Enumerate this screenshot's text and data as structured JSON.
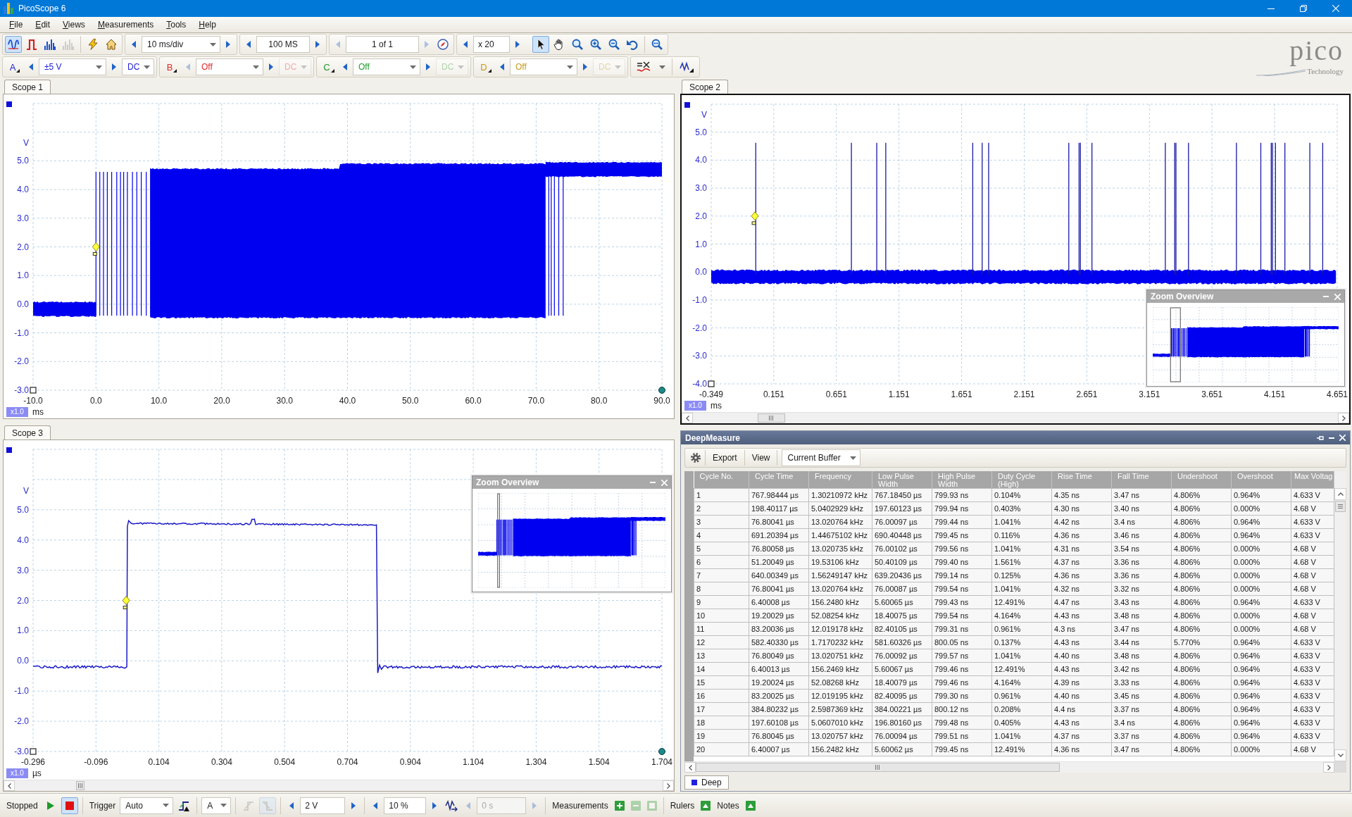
{
  "window": {
    "title": "PicoScope 6"
  },
  "menu": [
    "File",
    "Edit",
    "Views",
    "Measurements",
    "Tools",
    "Help"
  ],
  "toolbar": {
    "view_modes": [
      {
        "selected": true,
        "disabled": false
      },
      {
        "selected": false,
        "disabled": false
      },
      {
        "selected": false,
        "disabled": false
      },
      {
        "selected": false,
        "disabled": true
      }
    ],
    "steppers": [
      {
        "kind": "dropdown",
        "value": "10 ms/div",
        "prev_enabled": true,
        "next_enabled": true
      },
      {
        "kind": "field",
        "value": "100 MS",
        "prev_enabled": true,
        "next_enabled": true
      },
      {
        "kind": "field",
        "value": "1 of 1",
        "prev_enabled": false,
        "next_enabled": false
      },
      {
        "kind": "field",
        "value": "x 20",
        "prev_enabled": true,
        "next_enabled": true
      }
    ],
    "tools": [
      {
        "selected": true
      },
      {
        "selected": false
      },
      {
        "selected": false
      },
      {
        "selected": false
      },
      {
        "selected": false
      },
      {
        "selected": false
      }
    ]
  },
  "logo": {
    "name": "pico",
    "tagline": "Technology"
  },
  "channels": [
    {
      "letter": "A",
      "color": "#2323d6",
      "range": "±5 V",
      "coupling": "DC",
      "enabled": true,
      "prev_enabled": true
    },
    {
      "letter": "B",
      "color": "#e02828",
      "range": "Off",
      "coupling": "DC",
      "enabled": false,
      "prev_enabled": false
    },
    {
      "letter": "C",
      "color": "#1f9a2e",
      "range": "Off",
      "coupling": "DC",
      "enabled": false,
      "prev_enabled": true
    },
    {
      "letter": "D",
      "color": "#c39a1c",
      "range": "Off",
      "coupling": "DC",
      "enabled": false,
      "prev_enabled": true
    }
  ],
  "scopes": [
    {
      "tab": "Scope 1",
      "kind": "burst",
      "active": false,
      "y_unit": "V",
      "y_ticks": [
        "5.0",
        "4.0",
        "3.0",
        "2.0",
        "1.0",
        "0.0",
        "-1.0",
        "-2.0",
        "-3.0"
      ],
      "x_ticks": [
        "-10.0",
        "0.0",
        "10.0",
        "20.0",
        "30.0",
        "40.0",
        "50.0",
        "60.0",
        "70.0",
        "80.0",
        "90.0"
      ],
      "scale": "x1.0",
      "x_unit": "ms"
    },
    {
      "tab": "Scope 2",
      "kind": "spikes",
      "active": true,
      "y_unit": "V",
      "y_ticks": [
        "5.0",
        "4.0",
        "3.0",
        "2.0",
        "1.0",
        "0.0",
        "-1.0",
        "-2.0",
        "-3.0",
        "-4.0"
      ],
      "x_ticks": [
        "-0.349",
        "0.151",
        "0.651",
        "1.151",
        "1.651",
        "2.151",
        "2.651",
        "3.151",
        "3.651",
        "4.151",
        "4.651"
      ],
      "scale": "x1.0",
      "x_unit": "ms",
      "zoom_overview": {
        "title": "Zoom Overview"
      }
    },
    {
      "tab": "Scope 3",
      "kind": "pulse",
      "active": false,
      "y_unit": "V",
      "y_ticks": [
        "5.0",
        "4.0",
        "3.0",
        "2.0",
        "1.0",
        "0.0",
        "-1.0",
        "-2.0",
        "-3.0"
      ],
      "x_ticks": [
        "-0.296",
        "-0.096",
        "0.104",
        "0.304",
        "0.504",
        "0.704",
        "0.904",
        "1.104",
        "1.304",
        "1.504",
        "1.704"
      ],
      "scale": "x1.0",
      "x_unit": "µs",
      "zoom_overview": {
        "title": "Zoom Overview"
      }
    }
  ],
  "deepmeasure": {
    "title": "DeepMeasure",
    "toolbar": {
      "export": "Export",
      "view": "View",
      "source": "Current Buffer"
    },
    "table": {
      "columns": [
        "Cycle No.",
        "Cycle Time",
        "Frequency",
        "Low Pulse Width",
        "High Pulse Width",
        "Duty Cycle (High)",
        "Rise Time",
        "Fall Time",
        "Undershoot",
        "Overshoot",
        "Max Voltag"
      ],
      "rows": [
        [
          "1",
          "767.98444 µs",
          "1.30210972 kHz",
          "767.18450 µs",
          "799.93 ns",
          "0.104%",
          "4.35 ns",
          "3.47 ns",
          "4.806%",
          "0.964%",
          "4.633 V"
        ],
        [
          "2",
          "198.40117 µs",
          "5.0402929 kHz",
          "197.60123 µs",
          "799.94 ns",
          "0.403%",
          "4.30 ns",
          "3.40 ns",
          "4.806%",
          "0.000%",
          "4.68 V"
        ],
        [
          "3",
          "76.80041 µs",
          "13.020764 kHz",
          "76.00097 µs",
          "799.44 ns",
          "1.041%",
          "4.42 ns",
          "3.4 ns",
          "4.806%",
          "0.964%",
          "4.633 V"
        ],
        [
          "4",
          "691.20394 µs",
          "1.44675102 kHz",
          "690.40448 µs",
          "799.45 ns",
          "0.116%",
          "4.36 ns",
          "3.46 ns",
          "4.806%",
          "0.964%",
          "4.633 V"
        ],
        [
          "5",
          "76.80058 µs",
          "13.020735 kHz",
          "76.00102 µs",
          "799.56 ns",
          "1.041%",
          "4.31 ns",
          "3.54 ns",
          "4.806%",
          "0.000%",
          "4.68 V"
        ],
        [
          "6",
          "51.20049 µs",
          "19.53106 kHz",
          "50.40109 µs",
          "799.40 ns",
          "1.561%",
          "4.37 ns",
          "3.36 ns",
          "4.806%",
          "0.000%",
          "4.68 V"
        ],
        [
          "7",
          "640.00349 µs",
          "1.56249147 kHz",
          "639.20436 µs",
          "799.14 ns",
          "0.125%",
          "4.36 ns",
          "3.36 ns",
          "4.806%",
          "0.000%",
          "4.68 V"
        ],
        [
          "8",
          "76.80041 µs",
          "13.020764 kHz",
          "76.00087 µs",
          "799.54 ns",
          "1.041%",
          "4.32 ns",
          "3.32 ns",
          "4.806%",
          "0.000%",
          "4.68 V"
        ],
        [
          "9",
          "6.40008 µs",
          "156.2480 kHz",
          "5.60065 µs",
          "799.43 ns",
          "12.491%",
          "4.47 ns",
          "3.43 ns",
          "4.806%",
          "0.964%",
          "4.633 V"
        ],
        [
          "10",
          "19.20029 µs",
          "52.08254 kHz",
          "18.40075 µs",
          "799.54 ns",
          "4.164%",
          "4.43 ns",
          "3.48 ns",
          "4.806%",
          "0.000%",
          "4.68 V"
        ],
        [
          "11",
          "83.20036 µs",
          "12.019178 kHz",
          "82.40105 µs",
          "799.31 ns",
          "0.961%",
          "4.3 ns",
          "3.47 ns",
          "4.806%",
          "0.000%",
          "4.68 V"
        ],
        [
          "12",
          "582.40330 µs",
          "1.7170232 kHz",
          "581.60326 µs",
          "800.05 ns",
          "0.137%",
          "4.43 ns",
          "3.44 ns",
          "5.770%",
          "0.964%",
          "4.633 V"
        ],
        [
          "13",
          "76.80049 µs",
          "13.020751 kHz",
          "76.00092 µs",
          "799.57 ns",
          "1.041%",
          "4.40 ns",
          "3.48 ns",
          "4.806%",
          "0.964%",
          "4.633 V"
        ],
        [
          "14",
          "6.40013 µs",
          "156.2469 kHz",
          "5.60067 µs",
          "799.46 ns",
          "12.491%",
          "4.43 ns",
          "3.42 ns",
          "4.806%",
          "0.964%",
          "4.633 V"
        ],
        [
          "15",
          "19.20024 µs",
          "52.08268 kHz",
          "18.40079 µs",
          "799.46 ns",
          "4.164%",
          "4.39 ns",
          "3.33 ns",
          "4.806%",
          "0.964%",
          "4.633 V"
        ],
        [
          "16",
          "83.20025 µs",
          "12.019195 kHz",
          "82.40095 µs",
          "799.30 ns",
          "0.961%",
          "4.40 ns",
          "3.45 ns",
          "4.806%",
          "0.964%",
          "4.633 V"
        ],
        [
          "17",
          "384.80232 µs",
          "2.5987369 kHz",
          "384.00221 µs",
          "800.12 ns",
          "0.208%",
          "4.4 ns",
          "3.37 ns",
          "4.806%",
          "0.964%",
          "4.633 V"
        ],
        [
          "18",
          "197.60108 µs",
          "5.0607010 kHz",
          "196.80160 µs",
          "799.48 ns",
          "0.405%",
          "4.43 ns",
          "3.4 ns",
          "4.806%",
          "0.964%",
          "4.633 V"
        ],
        [
          "19",
          "76.80045 µs",
          "13.020757 kHz",
          "76.00094 µs",
          "799.51 ns",
          "1.041%",
          "4.37 ns",
          "3.37 ns",
          "4.806%",
          "0.964%",
          "4.633 V"
        ],
        [
          "20",
          "6.40007 µs",
          "156.2482 kHz",
          "5.60062 µs",
          "799.45 ns",
          "12.491%",
          "4.36 ns",
          "3.47 ns",
          "4.806%",
          "0.000%",
          "4.68 V"
        ]
      ]
    },
    "tabs": [
      {
        "label": "Deep",
        "selected": true
      }
    ]
  },
  "status_bar": {
    "run_state": "Stopped",
    "running": false,
    "trigger_label": "Trigger",
    "trigger_mode": "Auto",
    "trigger_source": "A",
    "edge_buttons": [
      {
        "selected": false,
        "disabled": true
      },
      {
        "selected": true,
        "disabled": true
      }
    ],
    "threshold": {
      "kind": "field",
      "value": "2 V",
      "prev_enabled": true,
      "next_enabled": true
    },
    "pre_trigger": {
      "kind": "field",
      "value": "10 %",
      "prev_enabled": true,
      "next_enabled": true
    },
    "delay": {
      "kind": "field",
      "value": "0 s",
      "prev_enabled": false,
      "next_enabled": false,
      "disabled": true
    },
    "measurements_label": "Measurements",
    "measurement_actions": [
      {
        "disabled": false
      },
      {
        "disabled": true
      },
      {
        "disabled": true
      }
    ],
    "rulers_label": "Rulers",
    "notes_label": "Notes"
  }
}
